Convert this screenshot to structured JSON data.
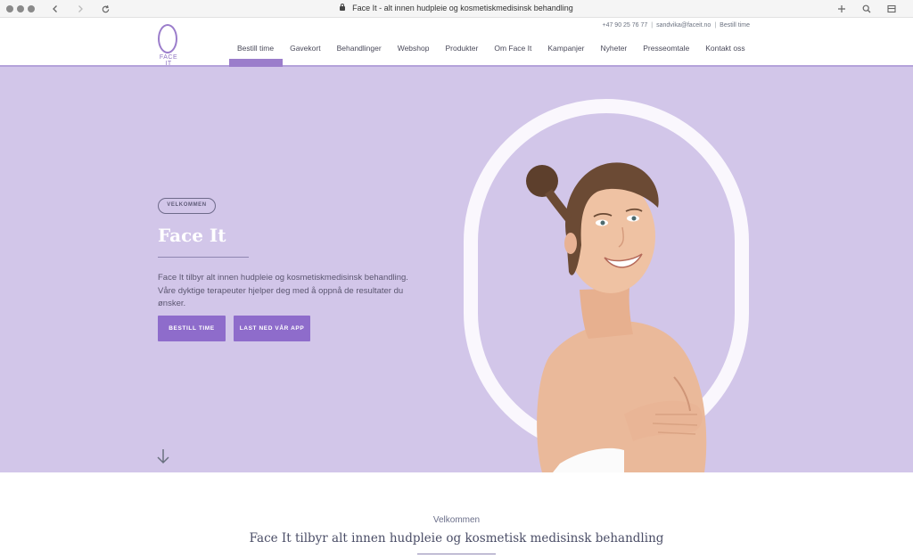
{
  "browser": {
    "title": "Face It - alt innen hudpleie og kosmetiskmedisinsk behandling",
    "icons": [
      "back-icon",
      "forward-icon",
      "reload-icon",
      "lock-icon",
      "new-tab-icon",
      "search-icon",
      "sidebar-icon"
    ]
  },
  "topbar": {
    "phone": "+47 90 25 76 77",
    "email": "sandvika@faceit.no",
    "book": "Bestill time"
  },
  "logo": {
    "text": "FACE IT"
  },
  "nav": {
    "items": [
      "Bestill time",
      "Gavekort",
      "Behandlinger",
      "Webshop",
      "Produkter",
      "Om Face It",
      "Kampanjer",
      "Nyheter",
      "Presseomtale",
      "Kontakt oss"
    ],
    "active": "Bestill time"
  },
  "hero": {
    "badge": "VELKOMMEN",
    "title": "Face It",
    "text": "Face It tilbyr alt innen hudpleie og kosmetiskmedisinsk behandling. Våre dyktige terapeuter hjelper deg med å oppnå de resultater du ønsker.",
    "button_book": "BESTILL TIME",
    "button_app": "LAST NED VÅR APP"
  },
  "section": {
    "label": "Velkommen",
    "title": "Face It tilbyr alt innen hudpleie og kosmetisk medisinsk behandling"
  },
  "colors": {
    "accent": "#8e6ccb",
    "hero_bg": "#d2c6e9",
    "ring": "#faf7fd"
  }
}
